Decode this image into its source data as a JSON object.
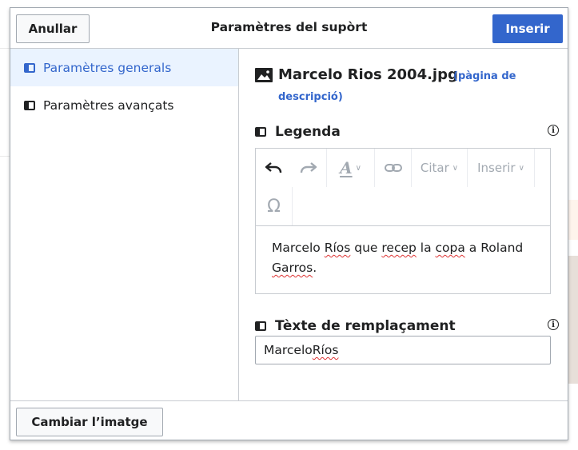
{
  "dialog": {
    "title": "Paramètres del supòrt",
    "cancel_label": "Anullar",
    "insert_label": "Inserir",
    "change_image_label": "Cambiar l’imatge"
  },
  "sidebar": {
    "items": [
      {
        "label": "Paramètres generals",
        "active": true
      },
      {
        "label": "Paramètres avançats",
        "active": false
      }
    ]
  },
  "file": {
    "name": "Marcelo Rios 2004.jpg",
    "link_part1": "(pàgina de",
    "link_part2": "descripció)"
  },
  "caption": {
    "label": "Legenda",
    "toolbar": {
      "undo_icon": "undo-icon",
      "redo_icon": "redo-icon",
      "style_icon": "text-style-icon",
      "link_icon": "link-icon",
      "cite_label": "Citar",
      "insert_label": "Inserir",
      "special_char_icon": "omega-icon"
    },
    "text_parts": [
      "Marcelo ",
      "Ríos",
      " que ",
      "recep",
      " la ",
      "copa",
      " a Roland ",
      "Garros",
      "."
    ]
  },
  "alt_text": {
    "label": "Tèxte de remplaçament",
    "value_parts": [
      "Marcelo ",
      "Ríos"
    ]
  },
  "colors": {
    "accent": "#3366cc",
    "active_bg": "#eaf3ff",
    "spell_error": "#dd3333"
  }
}
